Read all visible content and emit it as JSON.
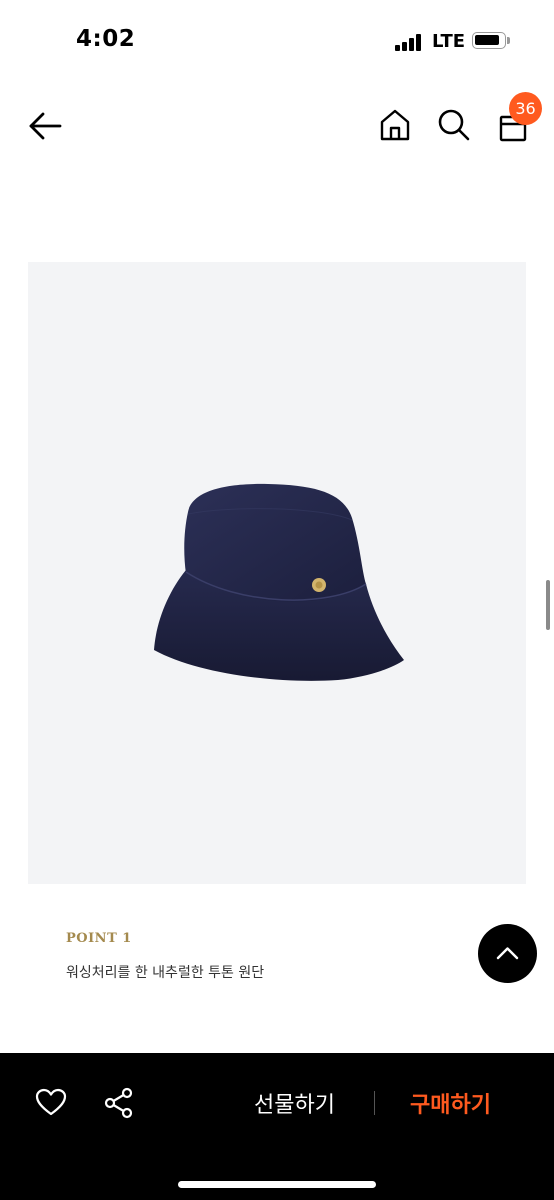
{
  "status_bar": {
    "time": "4:02",
    "network": "LTE"
  },
  "nav": {
    "back_icon": "arrow-left-icon",
    "home_icon": "home-icon",
    "search_icon": "search-icon",
    "cart_icon": "shopping-bag-icon",
    "cart_count": "36"
  },
  "product": {
    "image_icon": "bucket-hat-image",
    "point_label": "POINT 1",
    "point_description": "워싱처리를 한 내추럴한 투톤 원단"
  },
  "bottom_bar": {
    "wishlist_icon": "heart-icon",
    "share_icon": "share-icon",
    "gift_label": "선물하기",
    "buy_label": "구매하기"
  },
  "colors": {
    "accent": "#ff5a1f",
    "point_gold": "#a48a4e",
    "bottom_bar": "#000000"
  }
}
